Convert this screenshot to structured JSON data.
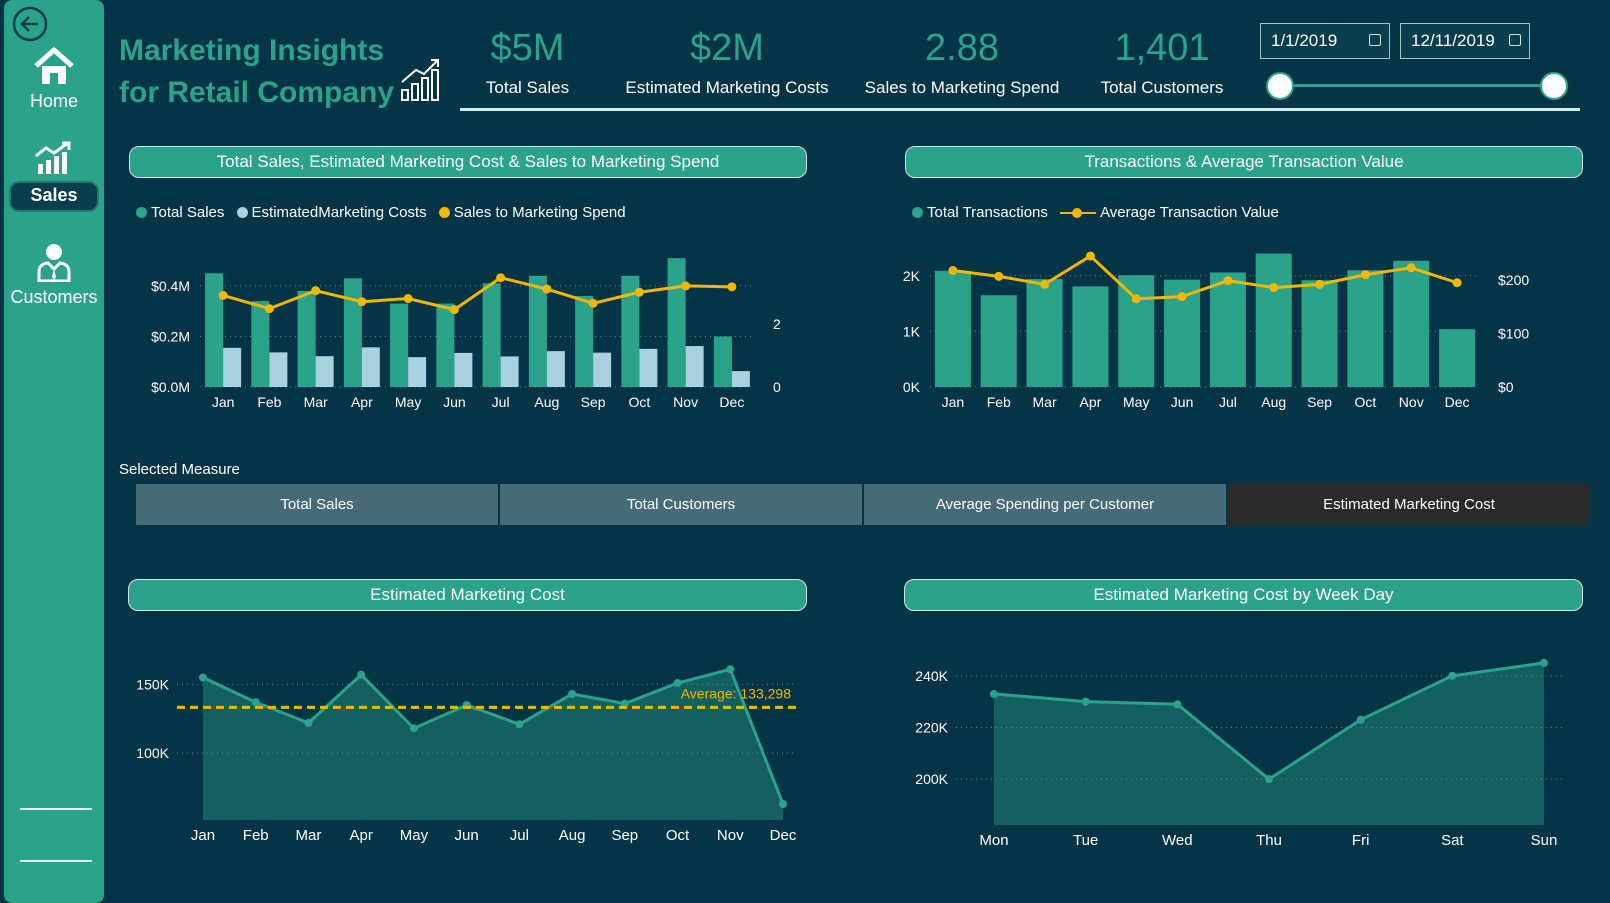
{
  "nav": {
    "home": "Home",
    "sales": "Sales",
    "customers": "Customers"
  },
  "header": {
    "title_line1": "Marketing Insights",
    "title_line2": "for Retail Company"
  },
  "kpis": [
    {
      "value": "$5M",
      "label": "Total Sales"
    },
    {
      "value": "$2M",
      "label": "Estimated Marketing Costs"
    },
    {
      "value": "2.88",
      "label": "Sales to Marketing Spend"
    },
    {
      "value": "1,401",
      "label": "Total Customers"
    }
  ],
  "date_filter": {
    "start": "1/1/2019",
    "end": "12/11/2019"
  },
  "panels": {
    "sales_cost": "Total Sales, Estimated Marketing Cost & Sales to Marketing Spend",
    "transactions": "Transactions & Average Transaction Value",
    "marketing_cost": "Estimated Marketing Cost",
    "marketing_weekday": "Estimated Marketing Cost by Week Day"
  },
  "legends": {
    "sales_cost": [
      "Total Sales",
      "EstimatedMarketing Costs",
      "Sales to Marketing Spend"
    ],
    "transactions": [
      "Total Transactions",
      "Average Transaction Value"
    ]
  },
  "selected_measure": {
    "label": "Selected Measure",
    "options": [
      "Total Sales",
      "Total Customers",
      "Average Spending per Customer",
      "Estimated Marketing Cost"
    ],
    "active_index": 3
  },
  "colors": {
    "teal": "#2ba38a",
    "light_blue": "#a9d2e0",
    "yellow": "#f2b705",
    "background": "#063447",
    "active_measure": "#2a2a2a"
  },
  "chart_data": [
    {
      "type": "bar",
      "title": "Total Sales, Estimated Marketing Cost & Sales to Marketing Spend",
      "categories": [
        "Jan",
        "Feb",
        "Mar",
        "Apr",
        "May",
        "Jun",
        "Jul",
        "Aug",
        "Sep",
        "Oct",
        "Nov",
        "Dec"
      ],
      "series": [
        {
          "name": "Total Sales",
          "values": [
            0.45,
            0.34,
            0.38,
            0.43,
            0.33,
            0.33,
            0.41,
            0.44,
            0.36,
            0.44,
            0.51,
            0.2
          ],
          "axis": "left"
        },
        {
          "name": "EstimatedMarketing Costs",
          "values": [
            0.155,
            0.137,
            0.122,
            0.157,
            0.118,
            0.135,
            0.121,
            0.142,
            0.136,
            0.151,
            0.162,
            0.063
          ],
          "axis": "left"
        },
        {
          "name": "Sales to Marketing Spend",
          "type": "line",
          "values": [
            2.9,
            2.48,
            3.05,
            2.7,
            2.8,
            2.45,
            3.46,
            3.1,
            2.65,
            3.0,
            3.2,
            3.17
          ],
          "axis": "right"
        }
      ],
      "y_ticks": [
        "$0.0M",
        "$0.2M",
        "$0.4M"
      ],
      "y2_ticks": [
        "0",
        "2"
      ],
      "ylim": [
        0,
        0.55
      ],
      "y2lim": [
        0,
        4.4
      ]
    },
    {
      "type": "bar",
      "title": "Transactions & Average Transaction Value",
      "categories": [
        "Jan",
        "Feb",
        "Mar",
        "Apr",
        "May",
        "Jun",
        "Jul",
        "Aug",
        "Sep",
        "Oct",
        "Nov",
        "Dec"
      ],
      "series": [
        {
          "name": "Total Transactions",
          "values": [
            2090,
            1650,
            1940,
            1810,
            2010,
            1930,
            2060,
            2400,
            1920,
            2100,
            2270,
            1040
          ],
          "axis": "left"
        },
        {
          "name": "Average Transaction Value",
          "type": "line",
          "values": [
            218,
            207,
            192,
            245,
            165,
            169,
            199,
            186,
            192,
            210,
            223,
            195
          ],
          "axis": "right"
        }
      ],
      "y_ticks": [
        "0K",
        "1K",
        "2K"
      ],
      "y2_ticks": [
        "$0",
        "$100",
        "$200"
      ],
      "ylim": [
        0,
        2500
      ],
      "y2lim": [
        0,
        260
      ]
    },
    {
      "type": "area",
      "title": "Estimated Marketing Cost",
      "categories": [
        "Jan",
        "Feb",
        "Mar",
        "Apr",
        "May",
        "Jun",
        "Jul",
        "Aug",
        "Sep",
        "Oct",
        "Nov",
        "Dec"
      ],
      "values": [
        155000,
        137000,
        122000,
        157000,
        118000,
        135000,
        121000,
        143000,
        136000,
        151000,
        161000,
        63000
      ],
      "average": 133298,
      "average_label": "Average: 133,298",
      "y_ticks": [
        "100K",
        "150K"
      ],
      "ylim": [
        55000,
        175000
      ]
    },
    {
      "type": "area",
      "title": "Estimated Marketing Cost by Week Day",
      "categories": [
        "Mon",
        "Tue",
        "Wed",
        "Thu",
        "Fri",
        "Sat",
        "Sun"
      ],
      "values": [
        233000,
        230000,
        229000,
        200000,
        223000,
        240000,
        245000
      ],
      "y_ticks": [
        "200K",
        "220K",
        "240K"
      ],
      "ylim": [
        190000,
        250000
      ]
    }
  ]
}
